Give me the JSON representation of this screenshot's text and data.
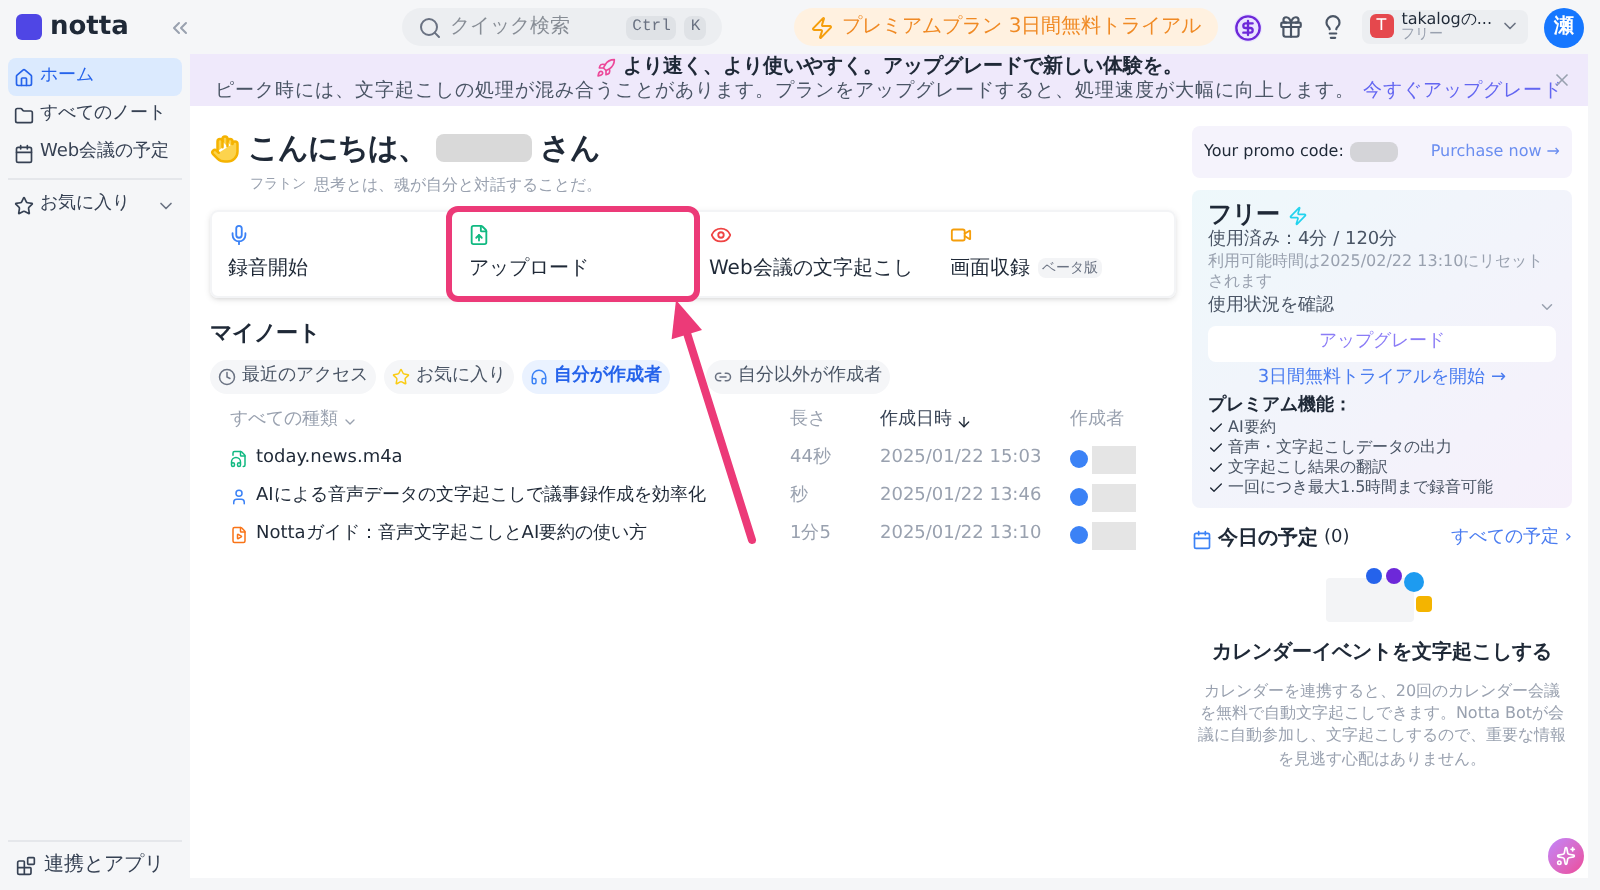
{
  "app": {
    "name": "notta"
  },
  "search": {
    "placeholder": "クイック検索",
    "keys": [
      "Ctrl",
      "K"
    ]
  },
  "premium_button": "プレミアムプラン 3日間無料トライアル",
  "account": {
    "name": "takalogの...",
    "plan": "フリー",
    "initial": "T",
    "avatar": "瀬"
  },
  "sidebar": {
    "items": [
      {
        "label": "ホーム",
        "selected": true
      },
      {
        "label": "すべてのノート",
        "selected": false
      },
      {
        "label": "Web会議の予定",
        "selected": false
      }
    ],
    "favorites": "お気に入り",
    "footer": "連携とアプリ"
  },
  "banner": {
    "title": "より速く、より使いやすく。アップグレードで新しい体験を。",
    "text": "ピーク時には、文字起こしの処理が混み合うことがあります。プランをアップグレードすると、処理速度が大幅に向上します。",
    "link": "今すぐアップグレード"
  },
  "greeting": {
    "hello": "こんにちは、",
    "suffix": "さん",
    "quote_author": "フラトン",
    "quote": "思考とは、魂が自分と対話することだ。"
  },
  "actions": [
    {
      "label": "録音開始",
      "kind": "mic",
      "highlighted": false
    },
    {
      "label": "アップロード",
      "kind": "upload",
      "highlighted": true
    },
    {
      "label": "Web会議の文字起こし",
      "kind": "meeting",
      "highlighted": false
    },
    {
      "label": "画面収録",
      "kind": "screen",
      "highlighted": false,
      "badge": "ベータ版"
    }
  ],
  "notes": {
    "title": "マイノート",
    "tabs": [
      {
        "label": "最近のアクセス",
        "selected": false
      },
      {
        "label": "お気に入り",
        "selected": false
      },
      {
        "label": "自分が作成者",
        "selected": true
      },
      {
        "label": "自分以外が作成者",
        "selected": false
      }
    ],
    "columns": [
      "すべての種類",
      "長さ",
      "作成日時",
      "作成者"
    ],
    "rows": [
      {
        "title": "today.news.m4a",
        "kind": "audio",
        "length": "44秒",
        "created": "2025/01/22 15:03"
      },
      {
        "title": "AIによる音声データの文字起こしで議事録作成を効率化",
        "kind": "person",
        "length": "秒",
        "created": "2025/01/22 13:46"
      },
      {
        "title": "Nottaガイド：音声文字起こしとAI要約の使い方",
        "kind": "video",
        "length": "1分5",
        "created": "2025/01/22 13:10"
      }
    ]
  },
  "promo": {
    "label": "Your promo code:",
    "link": "Purchase now →"
  },
  "plan": {
    "name": "フリー",
    "usage": "使用済み：4分 / 120分",
    "reset": "利用可能時間は2025/02/22 13:10にリセットされます",
    "check": "使用状況を確認",
    "upgrade": "アップグレード",
    "trial": "3日間無料トライアルを開始 →",
    "features_title": "プレミアム機能：",
    "features": [
      "AI要約",
      "音声・文字起こしデータの出力",
      "文字起こし結果の翻訳",
      "一回につき最大1.5時間まで録音可能"
    ]
  },
  "calendar": {
    "title": "今日の予定",
    "count": "(0)",
    "link": "すべての予定 ›",
    "heading": "カレンダーイベントを文字起こしする",
    "text": "カレンダーを連携すると、20回のカレンダー会議を無料で自動文字起こしできます。Notta Botが会議に自動参加し、文字起こしするので、重要な情報を見逃す心配はありません。"
  }
}
